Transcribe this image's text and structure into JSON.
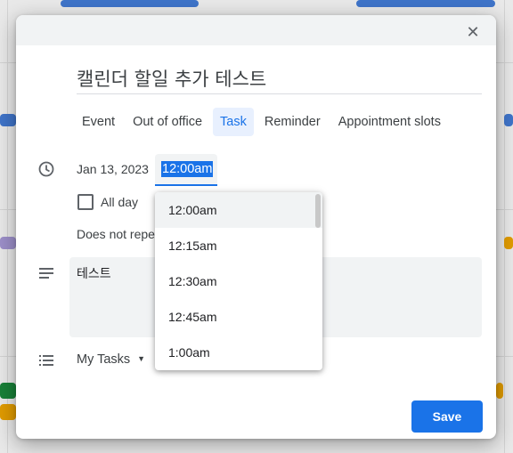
{
  "dialog": {
    "close_label": "✕",
    "title_value": "캘린더 할일 추가 테스트",
    "tabs": [
      {
        "label": "Event"
      },
      {
        "label": "Out of office"
      },
      {
        "label": "Task"
      },
      {
        "label": "Reminder"
      },
      {
        "label": "Appointment slots"
      }
    ],
    "active_tab": "Task",
    "date": "Jan 13, 2023",
    "time": "12:00am",
    "all_day_label": "All day",
    "all_day_checked": false,
    "repeat_label": "Does not repeat",
    "description": "테스트",
    "task_list": "My Tasks",
    "save_label": "Save"
  },
  "time_dropdown": {
    "options": [
      "12:00am",
      "12:15am",
      "12:30am",
      "12:45am",
      "1:00am"
    ],
    "highlighted": "12:00am"
  },
  "icons": [
    "close-icon",
    "clock-icon",
    "description-icon",
    "list-icon",
    "caret-down-icon"
  ],
  "colors": {
    "accent": "#1a73e8",
    "field_bg": "#f1f3f4",
    "text": "#3c4043"
  }
}
